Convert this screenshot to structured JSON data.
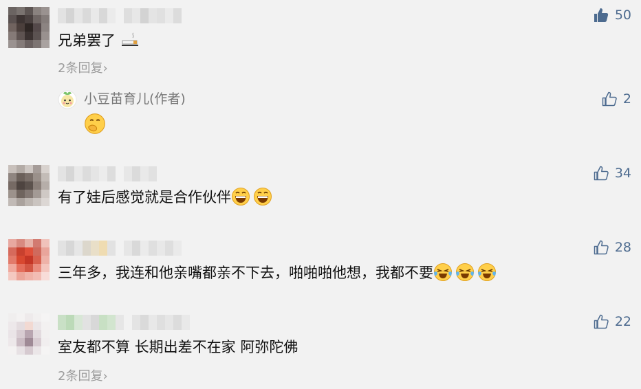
{
  "comments": [
    {
      "text": "兄弟罢了",
      "emoji": "cigarette-emoji",
      "likes": "50",
      "liked": true,
      "replies": "2条回复›",
      "reply": {
        "author": "小豆苗育儿(作者)",
        "emoji": "thinking-hand-over-mouth-emoji",
        "likes": "2"
      }
    },
    {
      "text": "有了娃后感觉就是合作伙伴",
      "emoji": "grinning-face-emoji",
      "likes": "34"
    },
    {
      "text": "三年多，我连和他亲嘴都亲不下去，啪啪啪他想，我都不要",
      "emoji": "crying-laughing-emoji",
      "likes": "28"
    },
    {
      "text": "室友都不算 长期出差不在家 阿弥陀佛",
      "likes": "22",
      "replies": "2条回复›"
    }
  ],
  "colors": {
    "liked": "#4d6b8f",
    "link": "#4d6b8f",
    "muted": "#9b9b9b"
  }
}
